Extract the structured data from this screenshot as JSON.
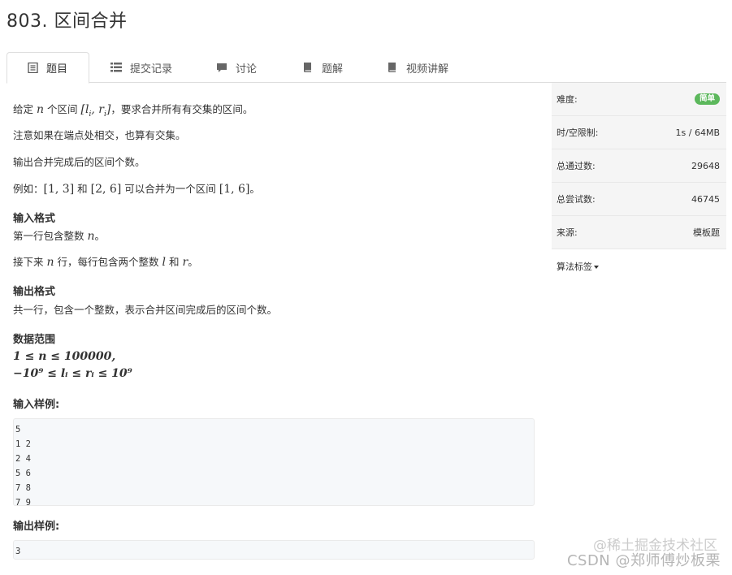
{
  "page": {
    "title": "803. 区间合并"
  },
  "tabs": [
    {
      "label": "题目",
      "icon": "document-icon",
      "active": true
    },
    {
      "label": "提交记录",
      "icon": "list-icon",
      "active": false
    },
    {
      "label": "讨论",
      "icon": "comment-icon",
      "active": false
    },
    {
      "label": "题解",
      "icon": "book-icon",
      "active": false
    },
    {
      "label": "视频讲解",
      "icon": "book-icon",
      "active": false
    }
  ],
  "problem": {
    "p1": {
      "a": "给定",
      "n": "n",
      "b": "个区间",
      "interval": "[l",
      "i": "i",
      "comma": ", r",
      "close": "]",
      "c": "，要求合并所有有交集的区间。"
    },
    "p2": "注意如果在端点处相交，也算有交集。",
    "p3": "输出合并完成后的区间个数。",
    "p4": {
      "a": "例如：",
      "m1": "[1, 3]",
      "b": "和",
      "m2": "[2, 6]",
      "c": "可以合并为一个区间",
      "m3": "[1, 6]",
      "d": "。"
    },
    "input_format_title": "输入格式",
    "input_line1": {
      "a": "第一行包含整数",
      "n": "n",
      "b": "。"
    },
    "input_line2": {
      "a": "接下来",
      "n": "n",
      "b": "行，每行包含两个整数",
      "l": "l",
      "c": "和",
      "r": "r",
      "d": "。"
    },
    "output_format_title": "输出格式",
    "output_line": "共一行，包含一个整数，表示合并区间完成后的区间个数。",
    "range_title": "数据范围",
    "range_line1": "1 ≤ n ≤ 100000,",
    "range_line2": "−10⁹ ≤ lᵢ ≤ rᵢ ≤ 10⁹",
    "sample_input_title": "输入样例:",
    "sample_input": [
      "5",
      "1 2",
      "2 4",
      "5 6",
      "7 8",
      "7 9"
    ],
    "sample_output_title": "输出样例:",
    "sample_output": [
      "3"
    ]
  },
  "side": {
    "rows": [
      {
        "label": "难度:",
        "value": "简单",
        "badge": true
      },
      {
        "label": "时/空限制:",
        "value": "1s / 64MB"
      },
      {
        "label": "总通过数:",
        "value": "29648"
      },
      {
        "label": "总尝试数:",
        "value": "46745"
      },
      {
        "label": "来源:",
        "value": "模板题"
      }
    ],
    "tags_label": "算法标签"
  },
  "watermark": {
    "line1": "@稀土掘金技术社区",
    "line2": "CSDN @郑师傅炒板栗"
  },
  "colors": {
    "badge": "#5cb85c",
    "panel_bg": "#f5f5f5",
    "code_bg": "#f6f8fa"
  }
}
